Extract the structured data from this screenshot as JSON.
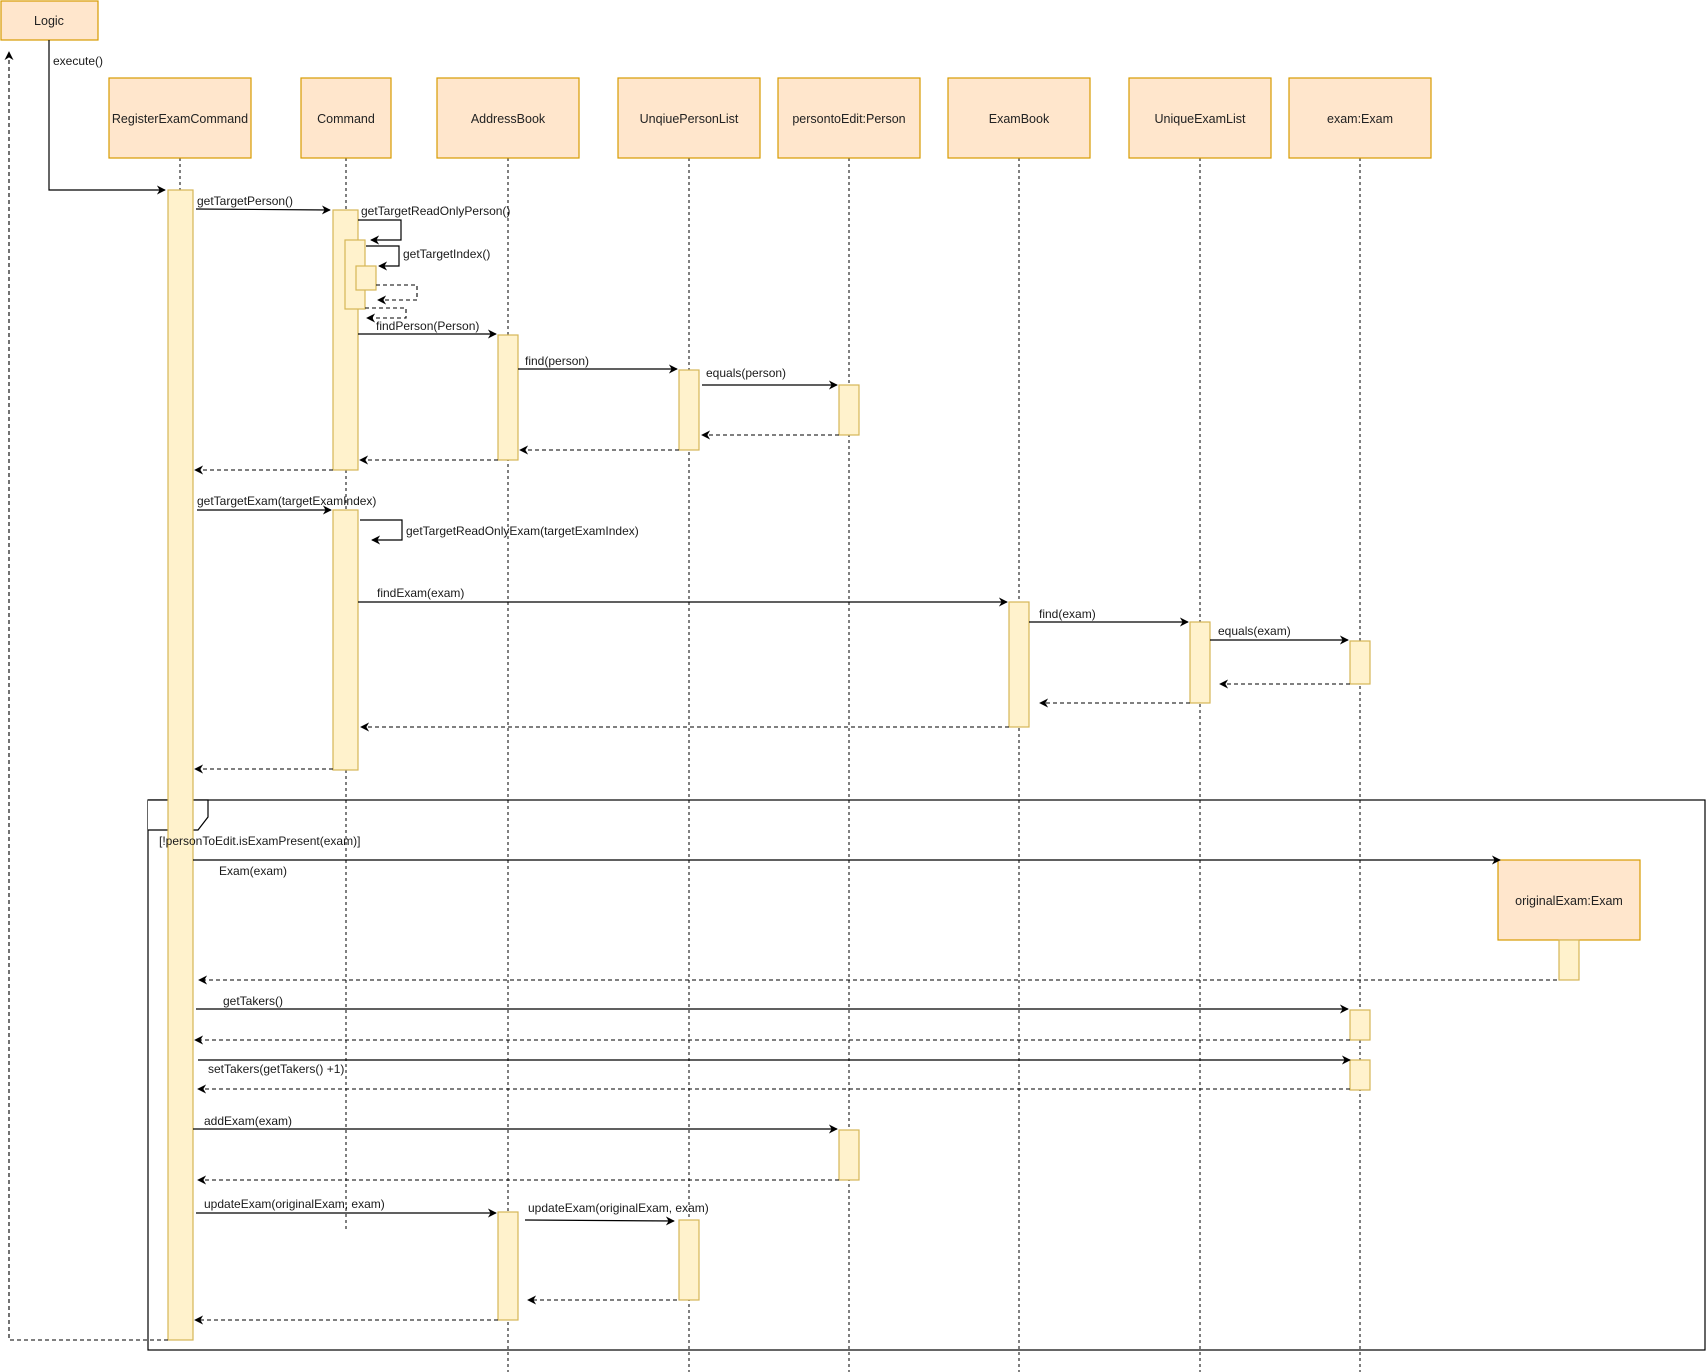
{
  "diagram": {
    "type": "sequence",
    "colors": {
      "participant_fill": "#ffe6cc",
      "participant_stroke": "#d79b00",
      "activation_fill": "#fff2cc",
      "activation_stroke": "#d6b656",
      "line": "#000000"
    },
    "actor": {
      "id": "logic",
      "label": "Logic"
    },
    "participants": [
      {
        "id": "rec",
        "label": "RegisterExamCommand"
      },
      {
        "id": "cmd",
        "label": "Command"
      },
      {
        "id": "ab",
        "label": "AddressBook"
      },
      {
        "id": "upl",
        "label": "UnqiuePersonList"
      },
      {
        "id": "pte",
        "label": "persontoEdit:Person"
      },
      {
        "id": "eb",
        "label": "ExamBook"
      },
      {
        "id": "uel",
        "label": "UniqueExamList"
      },
      {
        "id": "ex",
        "label": "exam:Exam"
      }
    ],
    "created_participant": {
      "id": "oe",
      "label": "originalExam:Exam"
    },
    "messages": [
      {
        "from": "logic",
        "to": "rec",
        "label": "execute()",
        "kind": "call"
      },
      {
        "from": "rec",
        "to": "cmd",
        "label": "getTargetPerson()",
        "kind": "call"
      },
      {
        "from": "cmd",
        "to": "cmd",
        "label": "getTargetReadOnlyPerson()",
        "kind": "self"
      },
      {
        "from": "cmd",
        "to": "cmd",
        "label": "getTargetIndex()",
        "kind": "self"
      },
      {
        "from": "cmd",
        "to": "ab",
        "label": "findPerson(Person)",
        "kind": "call"
      },
      {
        "from": "ab",
        "to": "upl",
        "label": "find(person)",
        "kind": "call"
      },
      {
        "from": "upl",
        "to": "pte",
        "label": "equals(person)",
        "kind": "call"
      },
      {
        "from": "rec",
        "to": "cmd",
        "label": "getTargetExam(targetExamIndex)",
        "kind": "call"
      },
      {
        "from": "cmd",
        "to": "cmd",
        "label": "getTargetReadOnlyExam(targetExamIndex)",
        "kind": "self"
      },
      {
        "from": "cmd",
        "to": "eb",
        "label": "findExam(exam)",
        "kind": "call"
      },
      {
        "from": "eb",
        "to": "uel",
        "label": "find(exam)",
        "kind": "call"
      },
      {
        "from": "uel",
        "to": "ex",
        "label": "equals(exam)",
        "kind": "call"
      },
      {
        "from": "rec",
        "to": "oe",
        "label": "Exam(exam)",
        "kind": "create"
      },
      {
        "from": "rec",
        "to": "ex",
        "label": "getTakers()",
        "kind": "call"
      },
      {
        "from": "rec",
        "to": "ex",
        "label": "setTakers(getTakers() +1)",
        "kind": "call"
      },
      {
        "from": "rec",
        "to": "pte",
        "label": "addExam(exam)",
        "kind": "call"
      },
      {
        "from": "rec",
        "to": "ab",
        "label": "updateExam(originalExam, exam)",
        "kind": "call"
      },
      {
        "from": "ab",
        "to": "upl",
        "label": "updateExam(originalExam, exam)",
        "kind": "call"
      }
    ],
    "fragment": {
      "operator": "ALT",
      "guard": "[!personToEdit.isExamPresent(exam)]"
    }
  }
}
